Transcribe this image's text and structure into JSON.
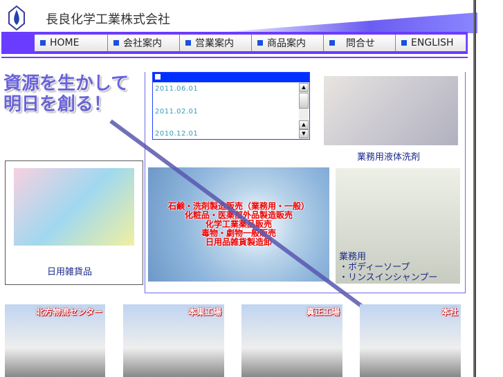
{
  "header": {
    "company": "長良化学工業株式会社"
  },
  "nav": [
    {
      "label": "HOME"
    },
    {
      "label": "会社案内"
    },
    {
      "label": "営業案内"
    },
    {
      "label": "商品案内"
    },
    {
      "label": "問合せ"
    },
    {
      "label": "ENGLISH"
    }
  ],
  "slogan": [
    "資源を生かして",
    "明日を創る！"
  ],
  "news": {
    "dates": [
      "2011.06.01",
      "2011.02.01",
      "2010.12.01"
    ]
  },
  "products": {
    "liquid": "業務用液体洗剤",
    "daily": "日用雑貨品",
    "body": [
      "業務用",
      "・ボディーソープ",
      "・リンスインシャンプー"
    ]
  },
  "business": [
    "石鹸・洗剤製造販売（業務用・一般）",
    "化粧品・医薬部外品製造販売",
    "化学工業薬品販売",
    "毒物・劇物一般販売",
    "日用品雑貨製造卸"
  ],
  "buildings": [
    "北方物流センター",
    "本巣工場",
    "真正工場",
    "本社"
  ],
  "colors": {
    "nav": "#6a3cff",
    "accent": "#0030ff",
    "business_text": "#ee0000"
  }
}
